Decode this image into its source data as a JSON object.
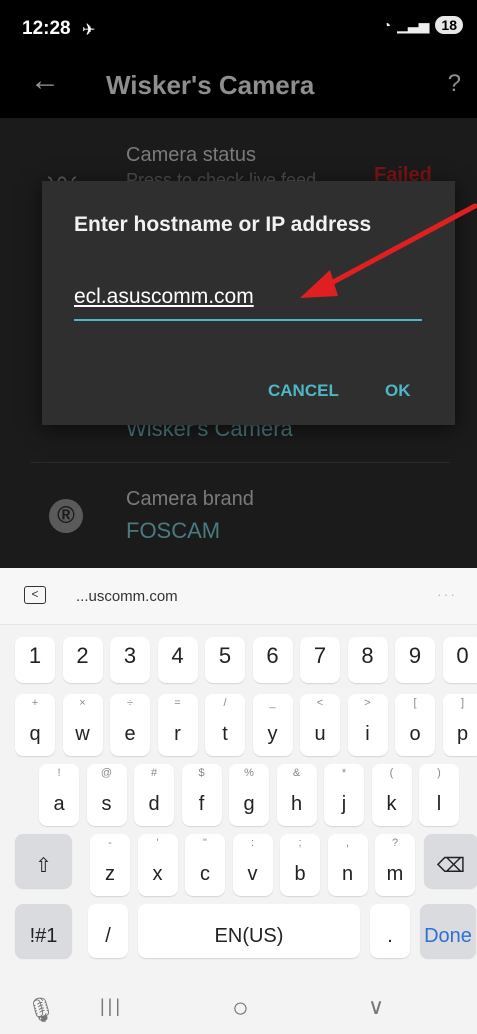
{
  "status": {
    "time": "12:28",
    "battery": "18"
  },
  "appbar": {
    "title": "Wisker's Camera",
    "back_icon": "←",
    "help_icon": "?"
  },
  "list": {
    "status_title": "Camera status",
    "status_sub": "Press to check live feed",
    "status_value": "Failed",
    "name_value": "Wisker's Camera",
    "brand_title": "Camera brand",
    "brand_value": "FOSCAM",
    "brand_icon": "®"
  },
  "dialog": {
    "title": "Enter hostname or IP address",
    "input_value": "ecl.asuscomm.com",
    "cancel_label": "CANCEL",
    "ok_label": "OK"
  },
  "keyboard": {
    "suggestion": "...uscomm.com",
    "suggest_more": "···",
    "numbers": [
      "1",
      "2",
      "3",
      "4",
      "5",
      "6",
      "7",
      "8",
      "9",
      "0"
    ],
    "row1": [
      {
        "k": "q",
        "h": "+"
      },
      {
        "k": "w",
        "h": "×"
      },
      {
        "k": "e",
        "h": "÷"
      },
      {
        "k": "r",
        "h": "="
      },
      {
        "k": "t",
        "h": "/"
      },
      {
        "k": "y",
        "h": "_"
      },
      {
        "k": "u",
        "h": "<"
      },
      {
        "k": "i",
        "h": ">"
      },
      {
        "k": "o",
        "h": "["
      },
      {
        "k": "p",
        "h": "]"
      }
    ],
    "row2": [
      {
        "k": "a",
        "h": "!"
      },
      {
        "k": "s",
        "h": "@"
      },
      {
        "k": "d",
        "h": "#"
      },
      {
        "k": "f",
        "h": "$"
      },
      {
        "k": "g",
        "h": "%"
      },
      {
        "k": "h",
        "h": "&"
      },
      {
        "k": "j",
        "h": "*"
      },
      {
        "k": "k",
        "h": "("
      },
      {
        "k": "l",
        "h": ")"
      }
    ],
    "row3": [
      {
        "k": "z",
        "h": "-"
      },
      {
        "k": "x",
        "h": "'"
      },
      {
        "k": "c",
        "h": "\""
      },
      {
        "k": "v",
        "h": ":"
      },
      {
        "k": "b",
        "h": ";"
      },
      {
        "k": "n",
        "h": ","
      },
      {
        "k": "m",
        "h": "?"
      }
    ],
    "shift": "⇧",
    "backspace": "⌫",
    "symbols": "!#1",
    "slash": "/",
    "space": "EN(US)",
    "period": ".",
    "done": "Done"
  },
  "navbar": {
    "mic_icon": "🎙",
    "recent_icon": "|||",
    "home_icon": "○",
    "back_icon": "∨"
  },
  "colors": {
    "accent": "#4fb6c6",
    "failed": "#c0201c",
    "arrow": "#e02020"
  }
}
